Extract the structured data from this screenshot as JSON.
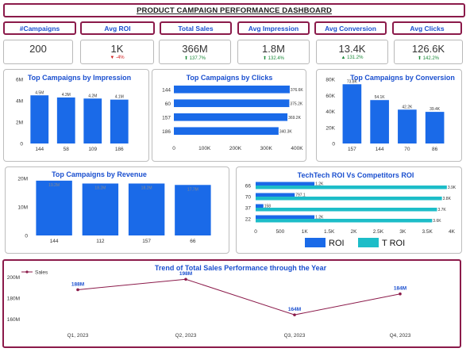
{
  "header": {
    "title": "PRODUCT CAMPAIGN PERFORMANCE DASHBOARD"
  },
  "kpis": [
    {
      "label": "#Campaigns",
      "value": "200",
      "delta": "",
      "dir": ""
    },
    {
      "label": "Avg ROI",
      "value": "1K",
      "delta": "-4%",
      "dir": "down"
    },
    {
      "label": "Total Sales",
      "value": "366M",
      "delta": "137.7%",
      "dir": "up"
    },
    {
      "label": "Avg Impression",
      "value": "1.8M",
      "delta": "132.4%",
      "dir": "up"
    },
    {
      "label": "Avg Conversion",
      "value": "13.4K",
      "delta": "131.2%",
      "dir": "up"
    },
    {
      "label": "Avg Clicks",
      "value": "126.6K",
      "delta": "142.2%",
      "dir": "up"
    }
  ],
  "colors": {
    "primary": "#1a6ae8",
    "secondary": "#1dbdc8",
    "line": "#8b1a4a",
    "border": "#8b1a4a",
    "label_blue": "#1a4fcf"
  },
  "chart_data": [
    {
      "id": "impression",
      "type": "bar",
      "title": "Top Campaigns by Impression",
      "categories": [
        "144",
        "58",
        "109",
        "186"
      ],
      "values": [
        4.5,
        4.3,
        4.2,
        4.1
      ],
      "data_labels": [
        "4.5M",
        "4.3M",
        "4.2M",
        "4.1M"
      ],
      "ylim": [
        0,
        6
      ],
      "yticks": [
        0,
        2,
        4,
        6
      ],
      "ytick_labels": [
        "0",
        "2M",
        "4M",
        "6M"
      ]
    },
    {
      "id": "clicks",
      "type": "bar",
      "orientation": "horizontal",
      "title": "Top Campaigns by Clicks",
      "categories": [
        "144",
        "60",
        "157",
        "186"
      ],
      "values": [
        376.6,
        375.2,
        369.2,
        340.3
      ],
      "data_labels": [
        "376.6K",
        "375.2K",
        "369.2K",
        "340.3K"
      ],
      "xlim": [
        0,
        400
      ],
      "xticks": [
        0,
        100,
        200,
        300,
        400
      ],
      "xtick_labels": [
        "0",
        "100K",
        "200K",
        "300K",
        "400K"
      ]
    },
    {
      "id": "conversion",
      "type": "bar",
      "title": "Top Campaigns by Conversion",
      "categories": [
        "157",
        "144",
        "70",
        "86"
      ],
      "values": [
        73.8,
        54.1,
        42.2,
        39.4
      ],
      "data_labels": [
        "73.8K",
        "54.1K",
        "42.2K",
        "39.4K"
      ],
      "ylim": [
        0,
        80
      ],
      "yticks": [
        0,
        20,
        40,
        60,
        80
      ],
      "ytick_labels": [
        "0",
        "20K",
        "40K",
        "60K",
        "80K"
      ]
    },
    {
      "id": "revenue",
      "type": "bar",
      "title": "Top Campaigns by Revenue",
      "categories": [
        "144",
        "112",
        "157",
        "66"
      ],
      "values": [
        19.2,
        18.2,
        18.2,
        17.7
      ],
      "data_labels": [
        "19.2M",
        "18.2M",
        "18.2M",
        "17.7M"
      ],
      "ylim": [
        0,
        20
      ],
      "yticks": [
        0,
        10,
        20
      ],
      "ytick_labels": [
        "0",
        "10M",
        "20M"
      ]
    },
    {
      "id": "roi",
      "type": "bar",
      "orientation": "horizontal",
      "title": "TechTech ROI Vs Competitors ROI",
      "categories": [
        "66",
        "70",
        "37",
        "22"
      ],
      "series": [
        {
          "name": "ROI",
          "values": [
            1.2,
            0.797,
            0.158,
            1.2
          ],
          "data_labels": [
            "1.2K",
            "797.1",
            "158",
            "1.2K"
          ]
        },
        {
          "name": "T ROI",
          "values": [
            3.9,
            3.8,
            3.7,
            3.6
          ],
          "data_labels": [
            "3.9K",
            "3.8K",
            "3.7K",
            "3.6K"
          ]
        }
      ],
      "xlim": [
        0,
        4
      ],
      "xticks": [
        0,
        0.5,
        1,
        1.5,
        2,
        2.5,
        3,
        3.5,
        4
      ],
      "xtick_labels": [
        "0",
        "500",
        "1K",
        "1.5K",
        "2K",
        "2.5K",
        "3K",
        "3.5K",
        "4K"
      ],
      "legend_position": "bottom"
    },
    {
      "id": "sales",
      "type": "line",
      "title": "Trend of Total Sales Performance through the Year",
      "categories": [
        "Q1, 2023",
        "Q2, 2023",
        "Q3, 2023",
        "Q4, 2023"
      ],
      "series": [
        {
          "name": "Sales",
          "values": [
            188,
            198,
            164,
            184
          ],
          "data_labels": [
            "188M",
            "198M",
            "164M",
            "184M"
          ]
        }
      ],
      "ylim": [
        155,
        205
      ],
      "yticks": [
        160,
        180,
        200
      ],
      "ytick_labels": [
        "160M",
        "180M",
        "200M"
      ],
      "legend_position": "top-left"
    }
  ]
}
